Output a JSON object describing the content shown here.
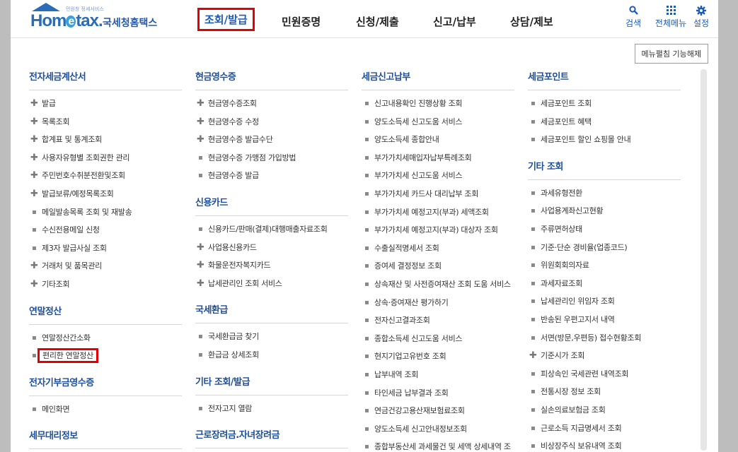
{
  "header": {
    "logo_small": "민원창 정세서비스",
    "logo_brand_a": "Hom",
    "logo_brand_e": "e",
    "logo_brand_b": "tax.",
    "logo_name": "국세청홈택스",
    "nav": [
      "조회/발급",
      "민원증명",
      "신청/제출",
      "신고/납부",
      "상담/제보"
    ],
    "active_nav": 0,
    "tools": [
      {
        "label": "검색",
        "icon": "search-icon"
      },
      {
        "label": "전체메뉴",
        "icon": "grid-icon"
      },
      {
        "label": "설정",
        "icon": "gear-icon"
      }
    ]
  },
  "toggle_label": "메뉴펼침 기능해제",
  "columns": [
    {
      "sections": [
        {
          "title": "전자세금계산서",
          "items": [
            {
              "label": "발급",
              "type": "plus"
            },
            {
              "label": "목록조회",
              "type": "plus"
            },
            {
              "label": "합계표 및 통계조회",
              "type": "plus"
            },
            {
              "label": "사용자유형별 조회권한 관리",
              "type": "plus"
            },
            {
              "label": "주민번호수취분전환및조회",
              "type": "plus"
            },
            {
              "label": "발급보류/예정목록조회",
              "type": "plus"
            },
            {
              "label": "메일발송목록 조회 및 재발송",
              "type": "dot"
            },
            {
              "label": "수신전용메일 신청",
              "type": "dot"
            },
            {
              "label": "제3자 발급사실 조회",
              "type": "dot"
            },
            {
              "label": "거래처 및 품목관리",
              "type": "plus"
            },
            {
              "label": "기타조회",
              "type": "plus"
            }
          ]
        },
        {
          "title": "연말정산",
          "items": [
            {
              "label": "연말정산간소화",
              "type": "dot"
            },
            {
              "label": "편리한 연말정산",
              "type": "dot",
              "highlight": true
            }
          ]
        },
        {
          "title": "전자기부금영수증",
          "items": [
            {
              "label": "메인화면",
              "type": "dot"
            }
          ]
        },
        {
          "title": "세무대리정보",
          "items": []
        }
      ]
    },
    {
      "sections": [
        {
          "title": "현금영수증",
          "items": [
            {
              "label": "현금영수증조회",
              "type": "plus"
            },
            {
              "label": "현금영수증 수정",
              "type": "plus"
            },
            {
              "label": "현금영수증 발급수단",
              "type": "plus"
            },
            {
              "label": "현금영수증 가맹점 가입방법",
              "type": "dot"
            },
            {
              "label": "현금영수증 발급",
              "type": "dot"
            }
          ]
        },
        {
          "title": "신용카드",
          "items": [
            {
              "label": "신용카드/판매(결제)대행매출자료조회",
              "type": "dot"
            },
            {
              "label": "사업용신용카드",
              "type": "plus"
            },
            {
              "label": "화물운전자복지카드",
              "type": "plus"
            },
            {
              "label": "납세관리인 조회 서비스",
              "type": "plus"
            }
          ]
        },
        {
          "title": "국세환급",
          "items": [
            {
              "label": "국세환급금 찾기",
              "type": "dot"
            },
            {
              "label": "환급금 상세조회",
              "type": "dot"
            }
          ]
        },
        {
          "title": "기타 조회/발급",
          "items": [
            {
              "label": "전자고지 열람",
              "type": "dot"
            }
          ]
        },
        {
          "title": "근로장려금.자녀장려금",
          "items": []
        }
      ]
    },
    {
      "sections": [
        {
          "title": "세금신고납부",
          "items": [
            {
              "label": "신고내용확인 진행상황 조회",
              "type": "dot"
            },
            {
              "label": "양도소득세 신고도움 서비스",
              "type": "dot"
            },
            {
              "label": "양도소득세 종합안내",
              "type": "dot"
            },
            {
              "label": "부가가치세매입자납부특례조회",
              "type": "dot"
            },
            {
              "label": "부가가치세 신고도움 서비스",
              "type": "dot"
            },
            {
              "label": "부가가치세 카드사 대리납부 조회",
              "type": "dot"
            },
            {
              "label": "부가가치세 예정고지(부과) 세액조회",
              "type": "dot"
            },
            {
              "label": "부가가치세 예정고지(부과) 대상자 조회",
              "type": "dot"
            },
            {
              "label": "수출실적명세서 조회",
              "type": "dot"
            },
            {
              "label": "증여세 결정정보 조회",
              "type": "dot"
            },
            {
              "label": "상속재산 및 사전증여재산 조회 도움 서비스",
              "type": "dot"
            },
            {
              "label": "상속·증여재산 평가하기",
              "type": "dot"
            },
            {
              "label": "전자신고결과조회",
              "type": "dot"
            },
            {
              "label": "종합소득세 신고도움 서비스",
              "type": "dot"
            },
            {
              "label": "현지기업고유번호 조회",
              "type": "dot"
            },
            {
              "label": "납부내역 조회",
              "type": "dot"
            },
            {
              "label": "타인세금 납부결과 조회",
              "type": "dot"
            },
            {
              "label": "연금건강고용산재보험료조회",
              "type": "dot"
            },
            {
              "label": "양도소득세 신고안내정보조회",
              "type": "dot"
            },
            {
              "label": "종합부동산세 과세물건 및 세액 상세내역 조",
              "type": "dot"
            }
          ]
        }
      ]
    },
    {
      "sections": [
        {
          "title": "세금포인트",
          "items": [
            {
              "label": "세금포인트 조회",
              "type": "dot"
            },
            {
              "label": "세금포인트 혜택",
              "type": "dot"
            },
            {
              "label": "세금포인트 할인 쇼핑몰 안내",
              "type": "dot"
            }
          ]
        },
        {
          "title": "기타 조회",
          "items": [
            {
              "label": "과세유형전환",
              "type": "dot"
            },
            {
              "label": "사업용계좌신고현황",
              "type": "dot"
            },
            {
              "label": "주류면허상태",
              "type": "dot"
            },
            {
              "label": "기준·단순 경비율(업종코드)",
              "type": "dot"
            },
            {
              "label": "위원회회의자료",
              "type": "dot"
            },
            {
              "label": "과세자료조회",
              "type": "dot"
            },
            {
              "label": "납세관리인 위임자 조회",
              "type": "dot"
            },
            {
              "label": "반송된 우편고지서 내역",
              "type": "dot"
            },
            {
              "label": "서면(방문,우편등) 접수현황조회",
              "type": "dot"
            },
            {
              "label": "기준시가 조회",
              "type": "plus"
            },
            {
              "label": "피상속인 국세관련 내역조회",
              "type": "dot"
            },
            {
              "label": "전통시장 정보 조회",
              "type": "dot"
            },
            {
              "label": "실손의료보험금 조회",
              "type": "dot"
            },
            {
              "label": "근로소득 지급명세서 조회",
              "type": "dot"
            },
            {
              "label": "비상장주식 보유내역 조회",
              "type": "dot"
            }
          ]
        }
      ]
    }
  ]
}
